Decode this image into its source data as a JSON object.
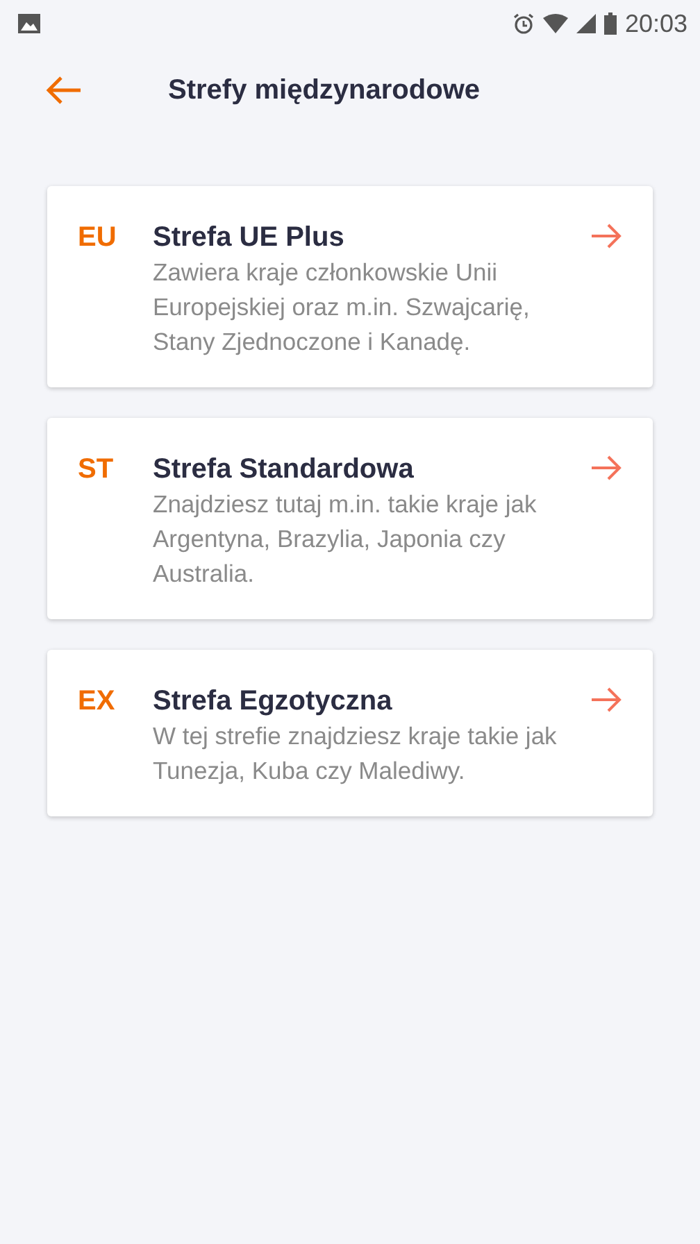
{
  "status_bar": {
    "time": "20:03"
  },
  "header": {
    "title": "Strefy międzynarodowe"
  },
  "zones": [
    {
      "code": "EU",
      "title": "Strefa UE Plus",
      "description": "Zawiera kraje członkowskie Unii Europejskiej oraz m.in. Szwajcarię, Stany Zjednoczone i Kanadę."
    },
    {
      "code": "ST",
      "title": "Strefa Standardowa",
      "description": "Znajdziesz tutaj m.in. takie kraje jak Argentyna, Brazylia, Japonia czy Australia."
    },
    {
      "code": "EX",
      "title": "Strefa Egzotyczna",
      "description": "W tej strefie znajdziesz kraje takie jak Tunezja, Kuba czy Malediwy."
    }
  ]
}
